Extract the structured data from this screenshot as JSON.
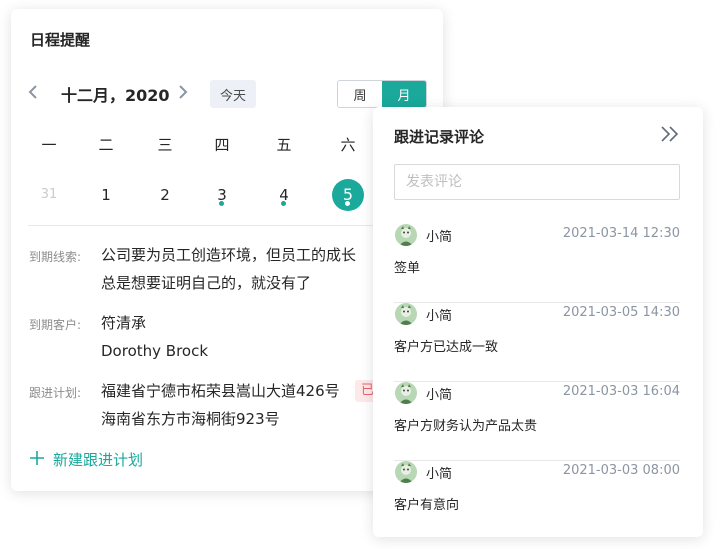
{
  "schedule": {
    "title": "日程提醒",
    "month_label": "十二月，2020",
    "today_label": "今天",
    "view_week": "周",
    "view_month": "月",
    "weekdays": [
      "一",
      "二",
      "三",
      "四",
      "五",
      "六"
    ],
    "days": [
      "31",
      "1",
      "2",
      "3",
      "4",
      "5"
    ],
    "fields": {
      "due_leads_label": "到期线索:",
      "due_leads_line1": "公司要为员工创造环境，但员工的成长",
      "due_leads_line2": "总是想要证明自己的，就没有了",
      "due_customers_label": "到期客户:",
      "due_customer_1": "符清承",
      "due_customer_2": "Dorothy Brock",
      "followup_label": "跟进计划:",
      "followup_1": "福建省宁德市柘荣县嵩山大道426号",
      "followup_tag": "已",
      "followup_2": "海南省东方市海桐街923号"
    },
    "new_plan_label": "新建跟进计划"
  },
  "comments": {
    "title": "跟进记录评论",
    "input_placeholder": "发表评论",
    "items": [
      {
        "user": "小简",
        "time": "2021-03-14 12:30",
        "text": "签单"
      },
      {
        "user": "小简",
        "time": "2021-03-05 14:30",
        "text": "客户方已达成一致"
      },
      {
        "user": "小简",
        "time": "2021-03-03 16:04",
        "text": "客户方财务认为产品太贵"
      },
      {
        "user": "小简",
        "time": "2021-03-03 08:00",
        "text": "客户有意向"
      }
    ]
  },
  "colors": {
    "accent": "#1aa99b",
    "tag_bg": "#fde9e9",
    "tag_text": "#e8636d"
  }
}
